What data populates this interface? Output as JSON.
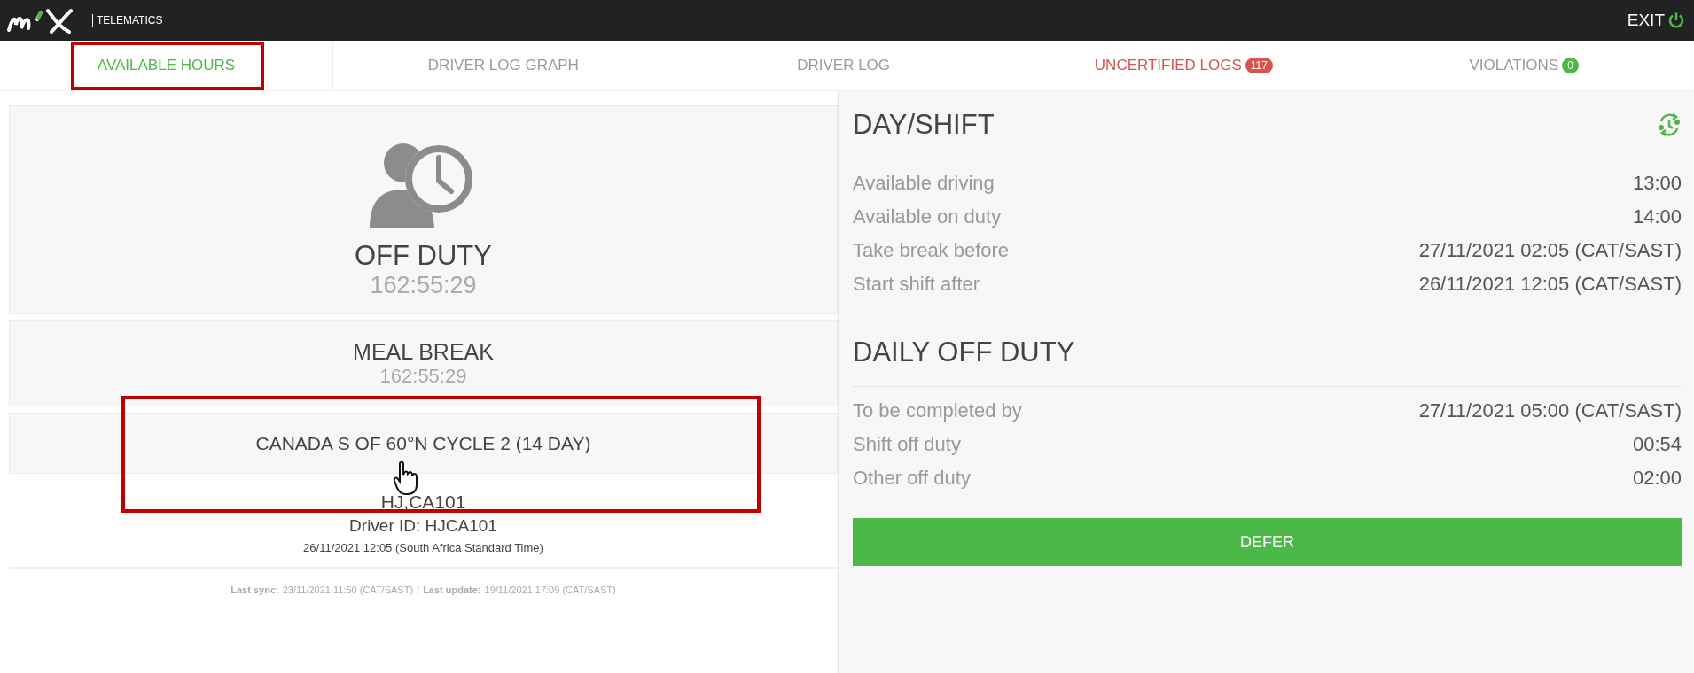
{
  "header": {
    "logo": "TELEMATICS",
    "exit": "EXIT"
  },
  "tabs": [
    {
      "label": "AVAILABLE HOURS",
      "selected": true
    },
    {
      "label": "DRIVER LOG GRAPH",
      "selected": false
    },
    {
      "label": "DRIVER LOG",
      "selected": false
    },
    {
      "label": "UNCERTIFIED LOGS",
      "selected": false,
      "kind": "alert",
      "badge": "117",
      "color": "#d9534f"
    },
    {
      "label": "VIOLATIONS",
      "selected": false,
      "kind": "plain",
      "badge": "0",
      "color": "#4cb848"
    }
  ],
  "status": {
    "title": "OFF DUTY",
    "time": "162:55:29"
  },
  "meal_break": {
    "title": "MEAL BREAK",
    "time": "162:55:29"
  },
  "cycle": "CANADA S OF 60°N CYCLE 2 (14 DAY)",
  "driver": {
    "name": "HJ,CA101",
    "id": "Driver ID: HJCA101",
    "time": "26/11/2021 12:05 (South Africa Standard Time)"
  },
  "sync": {
    "last_sync_label": "Last sync:",
    "last_sync": "23/11/2021 11:50 (CAT/SAST)",
    "separator": "/",
    "last_update_label": "Last update:",
    "last_update": "19/11/2021 17:09 (CAT/SAST)"
  },
  "sections": [
    {
      "title": "DAY/SHIFT",
      "rows": [
        {
          "label": "Available driving",
          "value": "13:00"
        },
        {
          "label": "Available on duty",
          "value": "14:00"
        },
        {
          "label": "Take break before",
          "value": "27/11/2021 02:05 (CAT/SAST)"
        },
        {
          "label": "Start shift after",
          "value": "26/11/2021 12:05 (CAT/SAST)"
        }
      ]
    },
    {
      "title": "DAILY OFF DUTY",
      "rows": [
        {
          "label": "To be completed by",
          "value": "27/11/2021 05:00 (CAT/SAST)"
        },
        {
          "label": "Shift off duty",
          "value": "00:54"
        },
        {
          "label": "Other off duty",
          "value": "02:00"
        }
      ]
    }
  ],
  "defer_button": "DEFER"
}
